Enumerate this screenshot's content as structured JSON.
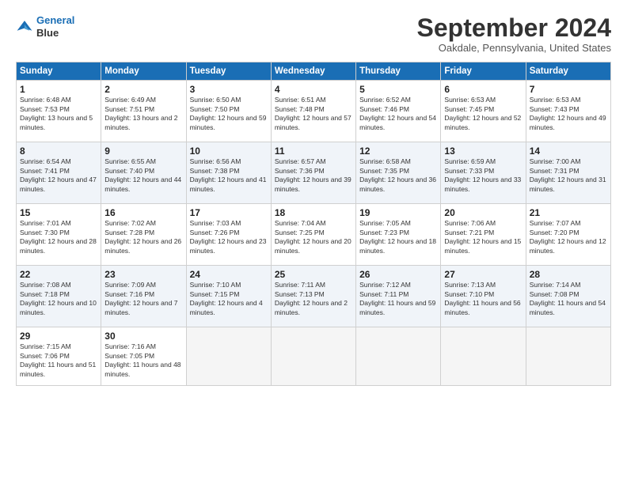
{
  "logo": {
    "line1": "General",
    "line2": "Blue"
  },
  "title": "September 2024",
  "location": "Oakdale, Pennsylvania, United States",
  "days_header": [
    "Sunday",
    "Monday",
    "Tuesday",
    "Wednesday",
    "Thursday",
    "Friday",
    "Saturday"
  ],
  "weeks": [
    [
      {
        "num": "1",
        "rise": "6:48 AM",
        "set": "7:53 PM",
        "daylight": "13 hours and 5 minutes."
      },
      {
        "num": "2",
        "rise": "6:49 AM",
        "set": "7:51 PM",
        "daylight": "13 hours and 2 minutes."
      },
      {
        "num": "3",
        "rise": "6:50 AM",
        "set": "7:50 PM",
        "daylight": "12 hours and 59 minutes."
      },
      {
        "num": "4",
        "rise": "6:51 AM",
        "set": "7:48 PM",
        "daylight": "12 hours and 57 minutes."
      },
      {
        "num": "5",
        "rise": "6:52 AM",
        "set": "7:46 PM",
        "daylight": "12 hours and 54 minutes."
      },
      {
        "num": "6",
        "rise": "6:53 AM",
        "set": "7:45 PM",
        "daylight": "12 hours and 52 minutes."
      },
      {
        "num": "7",
        "rise": "6:53 AM",
        "set": "7:43 PM",
        "daylight": "12 hours and 49 minutes."
      }
    ],
    [
      {
        "num": "8",
        "rise": "6:54 AM",
        "set": "7:41 PM",
        "daylight": "12 hours and 47 minutes."
      },
      {
        "num": "9",
        "rise": "6:55 AM",
        "set": "7:40 PM",
        "daylight": "12 hours and 44 minutes."
      },
      {
        "num": "10",
        "rise": "6:56 AM",
        "set": "7:38 PM",
        "daylight": "12 hours and 41 minutes."
      },
      {
        "num": "11",
        "rise": "6:57 AM",
        "set": "7:36 PM",
        "daylight": "12 hours and 39 minutes."
      },
      {
        "num": "12",
        "rise": "6:58 AM",
        "set": "7:35 PM",
        "daylight": "12 hours and 36 minutes."
      },
      {
        "num": "13",
        "rise": "6:59 AM",
        "set": "7:33 PM",
        "daylight": "12 hours and 33 minutes."
      },
      {
        "num": "14",
        "rise": "7:00 AM",
        "set": "7:31 PM",
        "daylight": "12 hours and 31 minutes."
      }
    ],
    [
      {
        "num": "15",
        "rise": "7:01 AM",
        "set": "7:30 PM",
        "daylight": "12 hours and 28 minutes."
      },
      {
        "num": "16",
        "rise": "7:02 AM",
        "set": "7:28 PM",
        "daylight": "12 hours and 26 minutes."
      },
      {
        "num": "17",
        "rise": "7:03 AM",
        "set": "7:26 PM",
        "daylight": "12 hours and 23 minutes."
      },
      {
        "num": "18",
        "rise": "7:04 AM",
        "set": "7:25 PM",
        "daylight": "12 hours and 20 minutes."
      },
      {
        "num": "19",
        "rise": "7:05 AM",
        "set": "7:23 PM",
        "daylight": "12 hours and 18 minutes."
      },
      {
        "num": "20",
        "rise": "7:06 AM",
        "set": "7:21 PM",
        "daylight": "12 hours and 15 minutes."
      },
      {
        "num": "21",
        "rise": "7:07 AM",
        "set": "7:20 PM",
        "daylight": "12 hours and 12 minutes."
      }
    ],
    [
      {
        "num": "22",
        "rise": "7:08 AM",
        "set": "7:18 PM",
        "daylight": "12 hours and 10 minutes."
      },
      {
        "num": "23",
        "rise": "7:09 AM",
        "set": "7:16 PM",
        "daylight": "12 hours and 7 minutes."
      },
      {
        "num": "24",
        "rise": "7:10 AM",
        "set": "7:15 PM",
        "daylight": "12 hours and 4 minutes."
      },
      {
        "num": "25",
        "rise": "7:11 AM",
        "set": "7:13 PM",
        "daylight": "12 hours and 2 minutes."
      },
      {
        "num": "26",
        "rise": "7:12 AM",
        "set": "7:11 PM",
        "daylight": "11 hours and 59 minutes."
      },
      {
        "num": "27",
        "rise": "7:13 AM",
        "set": "7:10 PM",
        "daylight": "11 hours and 56 minutes."
      },
      {
        "num": "28",
        "rise": "7:14 AM",
        "set": "7:08 PM",
        "daylight": "11 hours and 54 minutes."
      }
    ],
    [
      {
        "num": "29",
        "rise": "7:15 AM",
        "set": "7:06 PM",
        "daylight": "11 hours and 51 minutes."
      },
      {
        "num": "30",
        "rise": "7:16 AM",
        "set": "7:05 PM",
        "daylight": "11 hours and 48 minutes."
      },
      null,
      null,
      null,
      null,
      null
    ]
  ]
}
